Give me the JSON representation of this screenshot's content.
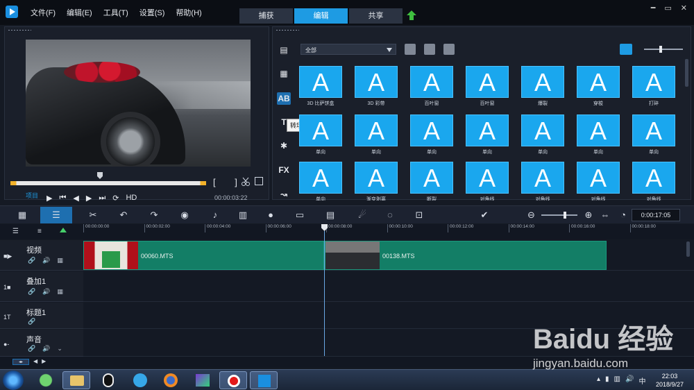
{
  "menu": [
    "文件(F)",
    "编辑(E)",
    "工具(T)",
    "设置(S)",
    "帮助(H)"
  ],
  "mode_tabs": [
    {
      "label": "捕获",
      "active": false
    },
    {
      "label": "编辑",
      "active": true
    },
    {
      "label": "共享",
      "active": false
    }
  ],
  "window_controls": [
    "━",
    "▭",
    "✕"
  ],
  "preview": {
    "brackets": "[ ]",
    "project_tab": "项目",
    "transport": [
      "▶",
      "⏮",
      "◀",
      "▶",
      "⏭",
      "⟳",
      "HD"
    ],
    "timecode": "00:00:03:22"
  },
  "library": {
    "category": "全部",
    "tooltip": "转场",
    "side_icons": [
      "media",
      "instant-project",
      "transition",
      "title",
      "graphic",
      "FX",
      "path"
    ],
    "side_fx_label": "FX",
    "side_title_label": "T",
    "tiles": [
      {
        "glyph": "A",
        "label": "3D 比萨饼盒"
      },
      {
        "glyph": "A",
        "label": "3D 彩带"
      },
      {
        "glyph": "A",
        "label": "百叶窗"
      },
      {
        "glyph": "A",
        "label": "百叶窗"
      },
      {
        "glyph": "A",
        "label": "爆裂"
      },
      {
        "glyph": "A",
        "label": "穿梭"
      },
      {
        "glyph": "A",
        "label": "打碎"
      },
      {
        "glyph": "A",
        "label": "单向"
      },
      {
        "glyph": "A",
        "label": "单向"
      },
      {
        "glyph": "A",
        "label": "单向"
      },
      {
        "glyph": "A",
        "label": "单向"
      },
      {
        "glyph": "A",
        "label": "单向"
      },
      {
        "glyph": "A",
        "label": "单向"
      },
      {
        "glyph": "A",
        "label": "单向"
      },
      {
        "glyph": "A",
        "label": "单向"
      },
      {
        "glyph": "A",
        "label": "渐变剥离"
      },
      {
        "glyph": "A",
        "label": "断裂"
      },
      {
        "glyph": "A",
        "label": "对角线"
      },
      {
        "glyph": "A",
        "label": "对角线"
      },
      {
        "glyph": "A",
        "label": "对角线"
      },
      {
        "glyph": "A",
        "label": "对角线"
      }
    ]
  },
  "timeline": {
    "timecode": "0:00:17:05",
    "ruler": [
      "00:00:00:00",
      "00:00:02:00",
      "00:00:04:00",
      "00:00:06:00",
      "00:00:08:00",
      "00:00:10:00",
      "00:00:12:00",
      "00:00:14:00",
      "00:00:16:00",
      "00:00:18:00"
    ],
    "tracks": [
      {
        "name": "视频",
        "icon": "video-track-icon"
      },
      {
        "name": "叠加1",
        "icon": "overlay-track-icon"
      },
      {
        "name": "标题1",
        "icon": "title-track-icon"
      },
      {
        "name": "声音",
        "icon": "voice-track-icon"
      }
    ],
    "clips": [
      {
        "name": "00060.MTS"
      },
      {
        "name": "00138.MTS"
      }
    ]
  },
  "taskbar": {
    "clock_time": "22:03",
    "clock_date": "2018/9/27"
  },
  "watermark": {
    "logo": "Baidu 经验",
    "url": "jingyan.baidu.com"
  }
}
